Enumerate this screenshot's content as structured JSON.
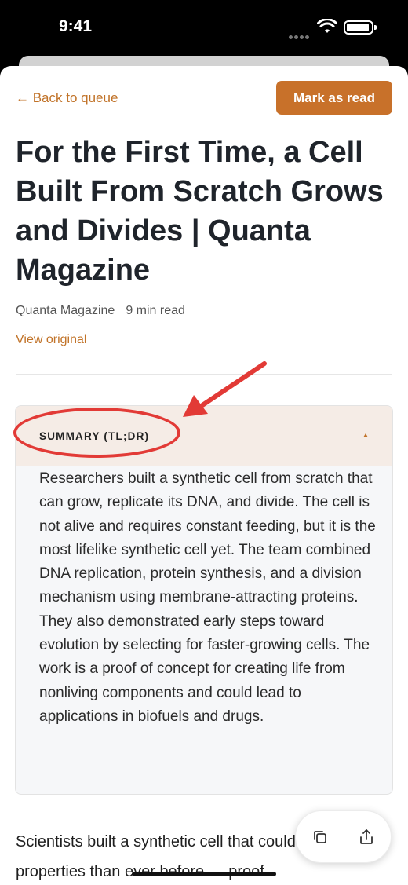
{
  "status": {
    "time": "9:41"
  },
  "topbar": {
    "back_label": "← Back to queue",
    "mark_read_label": "Mark as read"
  },
  "article": {
    "title": "For the First Time, a Cell Built From Scratch Grows and Divides | Quanta Magazine",
    "source": "Quanta Magazine",
    "read_time": "9 min read",
    "view_original_label": "View original",
    "body_preview": "Scientists built a synthetic cell that could more lifelike properties than ever before — proof"
  },
  "summary": {
    "label": "SUMMARY (TL;DR)",
    "text": "Researchers built a synthetic cell from scratch that can grow, replicate its DNA, and divide. The cell is not alive and requires constant feeding, but it is the most lifelike synthetic cell yet. The team combined DNA replication, protein synthesis, and a division mechanism using membrane-attracting proteins. They also demonstrated early steps toward evolution by selecting for faster-growing cells. The work is a proof of concept for creating life from nonliving components and could lead to applications in biofuels and drugs."
  },
  "fab": {
    "actions": [
      "copy-icon",
      "share-icon"
    ]
  },
  "colors": {
    "accent": "#c8712a",
    "annotation": "#e23a36",
    "summary_header_bg": "#f5ece6",
    "title": "#1f242b"
  }
}
